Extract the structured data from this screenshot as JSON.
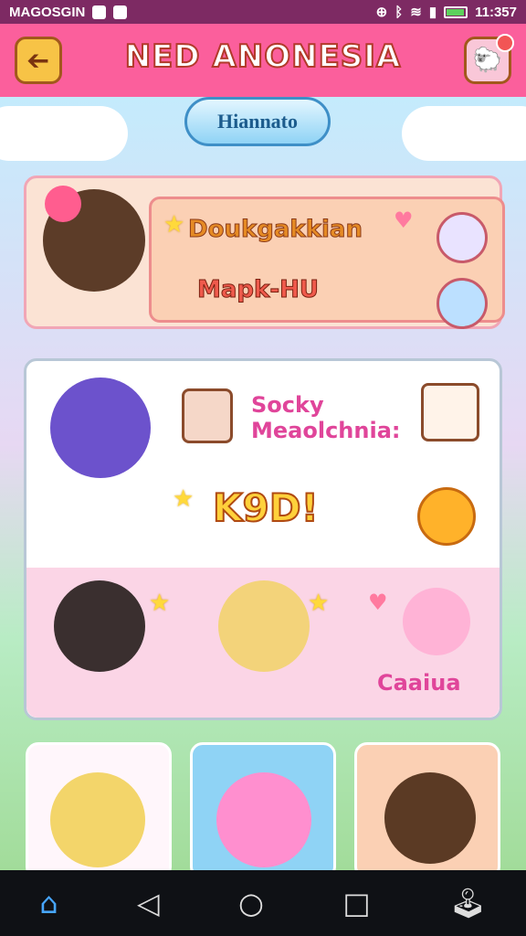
{
  "status_bar": {
    "left_text": "MAGOSGIN",
    "time": "11:357"
  },
  "header": {
    "title": "NED ANONESIA",
    "back_glyph": "➔",
    "menu_glyph": "🐑"
  },
  "scene_pill": {
    "label": "Hiannato"
  },
  "card1": {
    "line1": "Doukgakkian",
    "line2": "Mapk-HU"
  },
  "card2": {
    "line1": "Socky",
    "line2": "Meaolchnia:",
    "big": "K9D!",
    "lower_label": "Caaiua"
  },
  "nav": {
    "home": "⌂",
    "back": "◁",
    "circle": "○",
    "square": "□",
    "extra": "🕹"
  },
  "colors": {
    "accent": "#fb5f9c",
    "title_outline": "#b23a2a",
    "button": "#f7c346"
  },
  "icons": [
    "home-icon",
    "back-icon",
    "home-circle-icon",
    "recent-apps-icon",
    "game-icon",
    "star-icon",
    "heart-icon"
  ]
}
